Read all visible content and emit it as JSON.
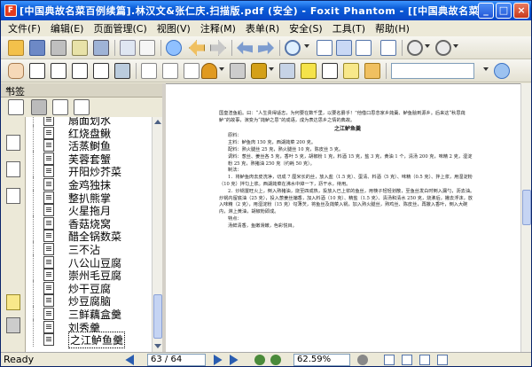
{
  "window": {
    "title": "[中国典故名菜百例续篇].林汉文&张仁庆.扫描版.pdf (安全) - Foxit Phantom - [[中国典故名菜..."
  },
  "menu": [
    "文件(F)",
    "编辑(E)",
    "页面管理(C)",
    "视图(V)",
    "注释(M)",
    "表单(R)",
    "安全(S)",
    "工具(T)",
    "帮助(H)"
  ],
  "sidebar": {
    "title": "书签",
    "bookmarks": [
      "扇面划水",
      "红烧盘鳅",
      "活蒸鲥鱼",
      "芙蓉套蟹",
      "开阳炒芥菜",
      "金鸡独抹",
      "整扒熊掌",
      "火星拖月",
      "香菇烧窝",
      "醋全锅数菜",
      "三不沾",
      "八公山豆腐",
      "崇州毛豆腐",
      "炒干豆腐",
      "炒豆腐脑",
      "三鲜藕盒羹",
      "刘秀羹",
      "之江鲈鱼羹"
    ],
    "selected_index": 17
  },
  "document": {
    "intro": "国皇渣鱼船。曰：“人生贵得适志，为何要在数千里，以要名爵乎！”他借口思念家乡莼羹、鲈鱼脍到源乡。后来这“秋思莼鲈”的故事，演变为“莼鲈之思”的成语，成为表达思乡之情的典故。",
    "dish_title": "之江鲈鱼羹",
    "ingredients_head": "原料：",
    "main_ing": "主料：鲈鱼肉 150 克，西湖莼菜 200 克。",
    "side_ing": "配料：熟火腿丝 25 克，熟火腿丝 10 克，陈皮丝 5 克。",
    "seasoning": "调料：葱丝、姜丝各 5 克，香叶 5 克，胡椒粉 1 克，料酒 15 克，盐 3 克，黄油 1 个，清汤 200 克，味精 2 克，湿淀粉 25 克，熟猪油 250 克（约耗 50 克）。",
    "method_head": "制法：",
    "step1": "1．将鲈鱼肉去皮洗净，切成 7 厘米长的丝，放入盐（1.5 克）、蛋清、料酒（5 克）、味精（0.5 克）、拌上浆，用湿淀粉（10 克）拌匀上浆。西湖莼菜在沸水中焯一下，沥干水，待用。",
    "step2": "2．炒锅置旺火上，倒入熟猪油，烧至四成热，投放入已上浆的鱼丝，用筷子轻轻划散，至鱼丝发白时倒入漏勺，沥去油。炒锅内留底油（25 克），投入葱姜丝煸香，加入料酒（10 克）、精盐（1.5 克）、清汤和清水 250 克，烧沸后，撇去浮沫，放入味精（2 克），用湿淀粉（15 克）勾薄芡，将鱼丝及莼菜入锅，加入熟火腿丝，熟鸡丝、陈皮丝，再撒入香叶，倒入大碗内，淋上黄油，胡椒粉即成。",
    "feature_head": "特点：",
    "feature": "汤鲜清香，鱼嫩滑嫩，色彩悦目。"
  },
  "status": {
    "ready": "Ready",
    "page": "63 / 64",
    "zoom": "62.59%"
  },
  "colors": {
    "titlebar": "#0a5bd7",
    "selection": "#316ac5"
  }
}
